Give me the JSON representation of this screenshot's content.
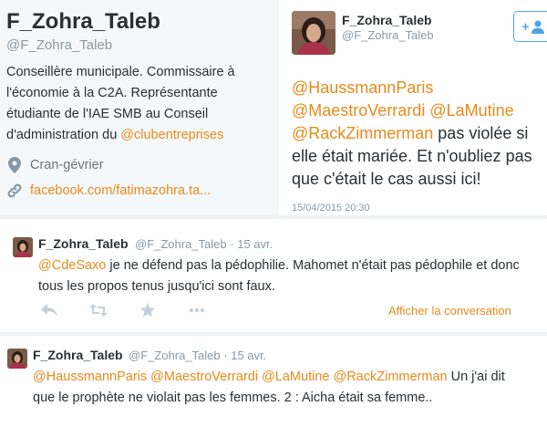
{
  "profile": {
    "display_name": "F_Zohra_Taleb",
    "handle": "@F_Zohra_Taleb",
    "bio_line1": "Conseillère municipale. Commissaire à",
    "bio_line2": "l'économie à la C2A. Représentante",
    "bio_line3": "étudiante de l'IAE SMB au Conseil",
    "bio_line4_prefix": "d'administration du ",
    "bio_mention": "@clubentreprises",
    "location": "Cran-gévrier",
    "website": "facebook.com/fatimazohra.ta...",
    "location_icon": "map-pin-icon",
    "link_icon": "link-icon"
  },
  "expanded_tweet": {
    "display_name": "F_Zohra_Taleb",
    "handle": "@F_Zohra_Taleb",
    "follow_icon": "add-user-icon",
    "follow_label": "+",
    "mention1": "@HaussmannParis",
    "mention2": "@MaestroVerrardi",
    "mention3": "@LaMutine",
    "mention4": "@RackZimmerman",
    "text_after_mentions": " pas violée si elle était mariée. Et n'oubliez pas que c'était le cas aussi ici!",
    "timestamp": "15/04/2015 20:30"
  },
  "tweets": [
    {
      "display_name": "F_Zohra_Taleb",
      "handle": "@F_Zohra_Taleb",
      "separator": "·",
      "date": "15 avr.",
      "mention": "@CdeSaxo",
      "text": " je ne défend pas la pédophilie. Mahomet n'était pas pédophile et donc tous les propos tenus jusqu'ici sont faux.",
      "view_conversation": "Afficher la conversation",
      "actions": [
        "reply-icon",
        "retweet-icon",
        "favorite-icon",
        "more-icon"
      ]
    },
    {
      "display_name": "F_Zohra_Taleb",
      "handle": "@F_Zohra_Taleb",
      "separator": "·",
      "date": "15 avr.",
      "mention1": "@HaussmannParis",
      "mention2": "@MaestroVerrardi",
      "mention3": "@LaMutine",
      "mention4": "@RackZimmerman",
      "text": " Un j'ai dit que le prophète ne violait pas les femmes. 2 : Aicha était sa femme.."
    }
  ],
  "colors": {
    "mention": "#e88a1a",
    "muted": "#8899a6",
    "text": "#292f33",
    "follow_blue": "#4fa3e3",
    "profile_bg": "#f5f8fa"
  }
}
